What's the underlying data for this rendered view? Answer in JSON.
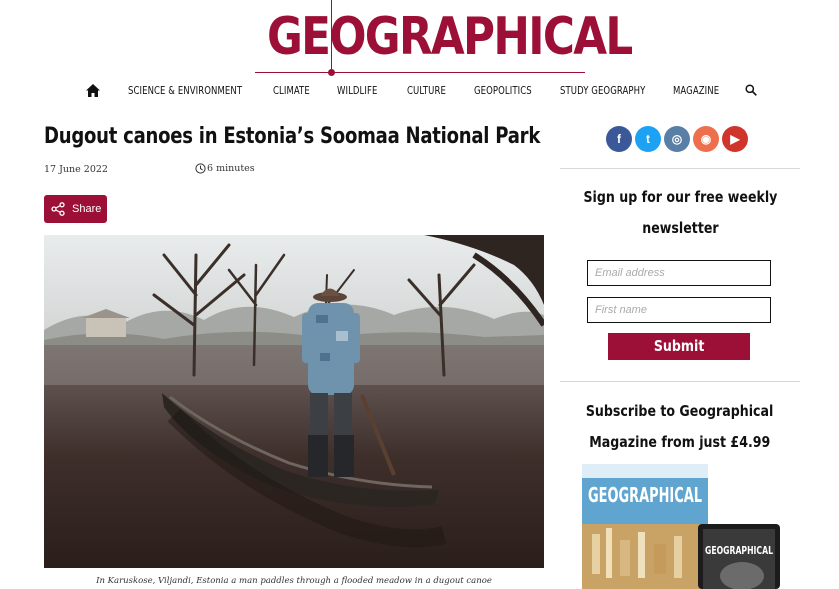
{
  "site": {
    "logo": "GEOGRAPHICAL",
    "brand_color": "#9c1037"
  },
  "nav": {
    "home_icon": "home-icon",
    "items": [
      "SCIENCE & ENVIRONMENT",
      "CLIMATE",
      "WILDLIFE",
      "CULTURE",
      "GEOPOLITICS",
      "STUDY GEOGRAPHY",
      "MAGAZINE"
    ],
    "search_icon": "search-icon"
  },
  "article": {
    "title": "Dugout canoes in Estonia’s Soomaa National Park",
    "date": "17 June 2022",
    "read_time": "6 minutes",
    "share_label": "Share",
    "caption": "In Karuskose, Viljandi, Estonia a man paddles through a flooded meadow in a dugout canoe"
  },
  "sidebar": {
    "social": [
      {
        "name": "facebook-icon",
        "glyph": "f",
        "color": "#3b5998"
      },
      {
        "name": "twitter-icon",
        "glyph": "t",
        "color": "#1da1f2"
      },
      {
        "name": "instagram-icon",
        "glyph": "◎",
        "color": "#5a7fa6"
      },
      {
        "name": "rss-icon",
        "glyph": "◉",
        "color": "#ee6f4c"
      },
      {
        "name": "youtube-icon",
        "glyph": "▶",
        "color": "#d0352c"
      }
    ],
    "newsletter": {
      "heading_line1": "Sign up for our free weekly",
      "heading_line2": "newsletter",
      "email_placeholder": "Email address",
      "firstname_placeholder": "First name",
      "submit_label": "Submit"
    },
    "subscribe": {
      "heading_line1": "Subscribe to Geographical",
      "heading_line2": "Magazine from just £4.99",
      "cover_title": "GEOGRAPHICAL",
      "tablet_title": "GEOGRAPHICAL"
    }
  }
}
